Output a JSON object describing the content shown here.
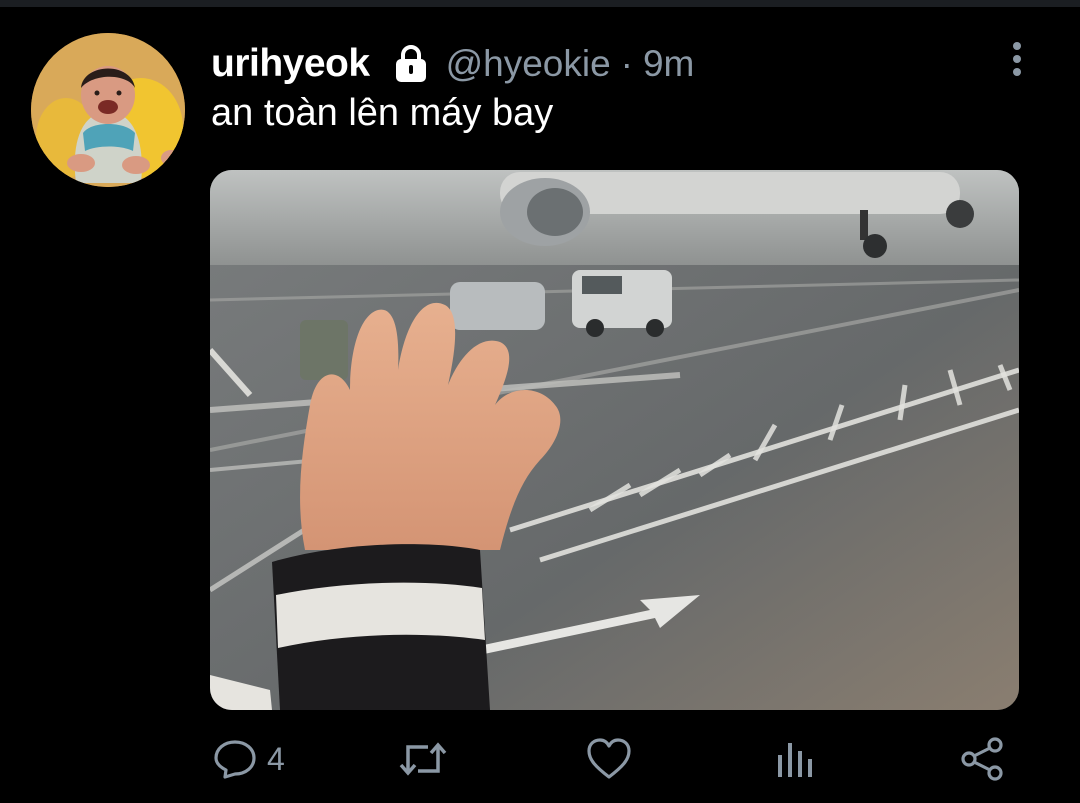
{
  "tweet": {
    "username": "urihyeok",
    "handle": "@hyeokie",
    "separator": "·",
    "time": "9m",
    "text": "an toàn lên máy bay",
    "protected": true,
    "avatar_icon": "baby-avatar",
    "image_icon": "photo-airplane-window"
  },
  "actions": {
    "reply_count": "4",
    "icons": [
      "reply-icon",
      "retweet-icon",
      "like-icon",
      "analytics-icon",
      "share-icon"
    ]
  },
  "colors": {
    "background": "#000000",
    "text": "#ffffff",
    "muted": "#8b98a5"
  }
}
